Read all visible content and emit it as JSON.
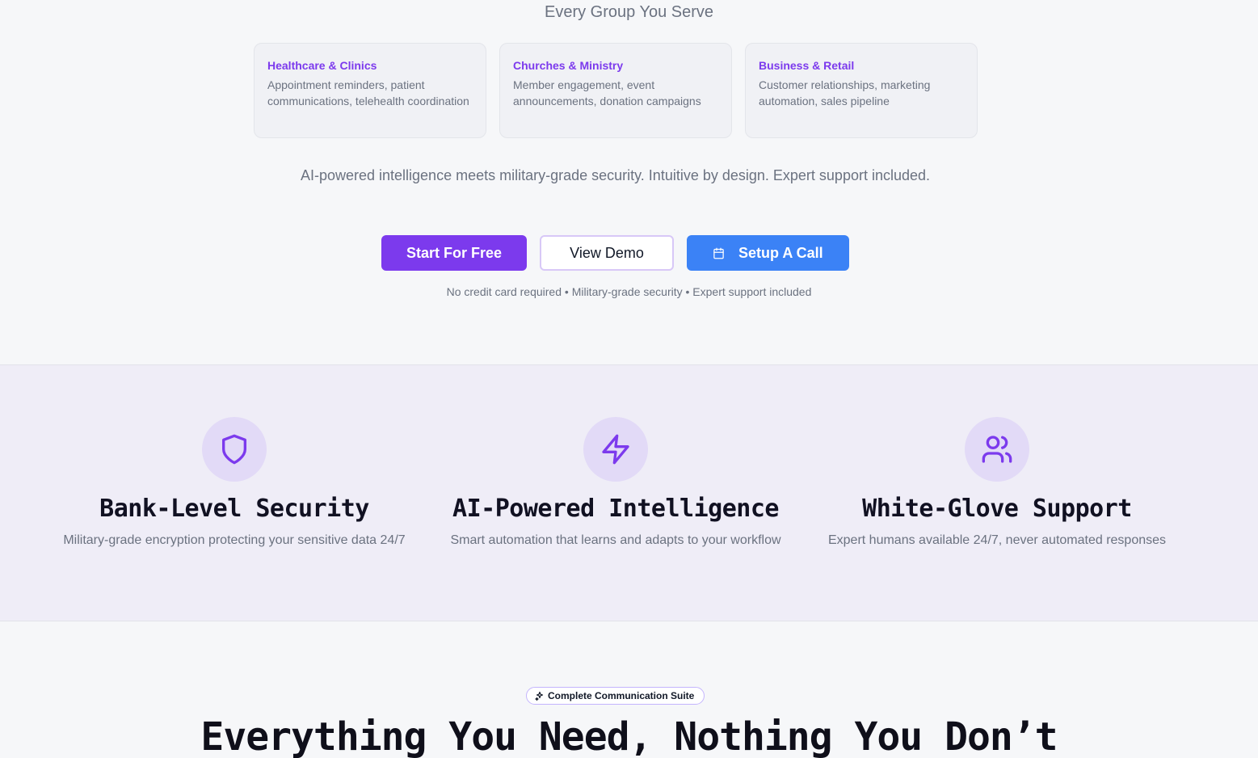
{
  "hero": {
    "subtitle": "Every Group You Serve",
    "groups": [
      {
        "title": "Healthcare & Clinics",
        "description": "Appointment reminders, patient communications, telehealth coordination"
      },
      {
        "title": "Churches & Ministry",
        "description": "Member engagement, event announcements, donation campaigns"
      },
      {
        "title": "Business & Retail",
        "description": "Customer relationships, marketing automation, sales pipeline"
      }
    ],
    "tagline": "AI-powered intelligence meets military-grade security. Intuitive by design. Expert support included.",
    "buttons": {
      "start": "Start For Free",
      "demo": "View Demo",
      "call": "Setup A Call"
    },
    "fine_print": "No credit card required • Military-grade security • Expert support included"
  },
  "features": [
    {
      "icon": "shield-icon",
      "title": "Bank-Level Security",
      "description": "Military-grade encryption protecting your sensitive data 24/7"
    },
    {
      "icon": "lightning-icon",
      "title": "AI-Powered Intelligence",
      "description": "Smart automation that learns and adapts to your workflow"
    },
    {
      "icon": "users-icon",
      "title": "White-Glove Support",
      "description": "Expert humans available 24/7, never automated responses"
    }
  ],
  "suite": {
    "badge": "Complete Communication Suite",
    "heading": "Everything You Need, Nothing You Don’t"
  },
  "colors": {
    "accent": "#7c3aed",
    "blue": "#3b82f6",
    "band": "#efedf7",
    "icon_bg": "#e2daf7"
  }
}
